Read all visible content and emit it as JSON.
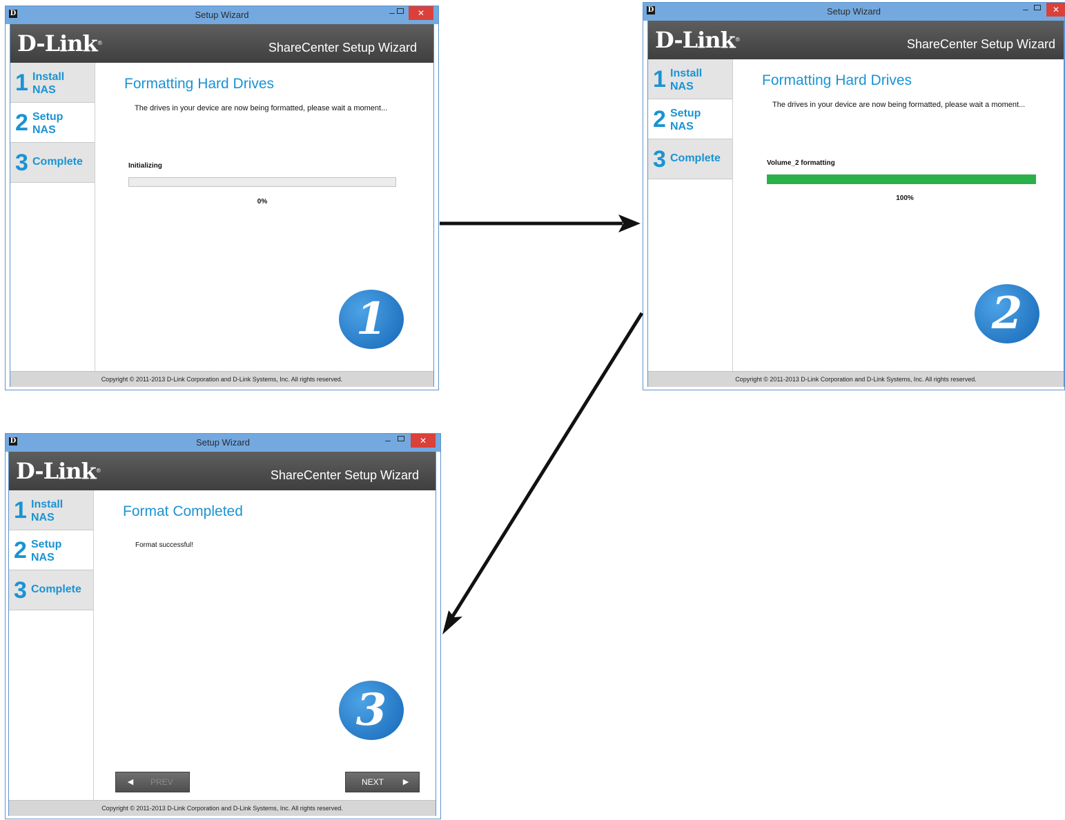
{
  "windows": [
    {
      "title": "Setup Wizard",
      "app_icon": "D",
      "brand": "D-Link",
      "subtitle": "ShareCenter Setup Wizard",
      "steps": [
        {
          "num": "1",
          "line1": "Install",
          "line2": "NAS"
        },
        {
          "num": "2",
          "line1": "Setup",
          "line2": "NAS"
        },
        {
          "num": "3",
          "line1": "Complete",
          "line2": ""
        }
      ],
      "heading": "Formatting Hard Drives",
      "description": "The drives in your device are now being formatted, please wait a moment...",
      "status": "Initializing",
      "progress_percent": 0,
      "progress_label": "0%",
      "badge": "1",
      "footer": "Copyright © 2011-2013 D-Link Corporation and D-Link Systems, Inc. All rights reserved."
    },
    {
      "title": "Setup Wizard",
      "app_icon": "D",
      "brand": "D-Link",
      "subtitle": "ShareCenter Setup Wizard",
      "steps": [
        {
          "num": "1",
          "line1": "Install",
          "line2": "NAS"
        },
        {
          "num": "2",
          "line1": "Setup",
          "line2": "NAS"
        },
        {
          "num": "3",
          "line1": "Complete",
          "line2": ""
        }
      ],
      "heading": "Formatting Hard Drives",
      "description": "The drives in your device are now being formatted, please wait a moment...",
      "status": "Volume_2 formatting",
      "progress_percent": 100,
      "progress_label": "100%",
      "badge": "2",
      "footer": "Copyright © 2011-2013 D-Link Corporation and D-Link Systems, Inc. All rights reserved."
    },
    {
      "title": "Setup Wizard",
      "app_icon": "D",
      "brand": "D-Link",
      "subtitle": "ShareCenter Setup Wizard",
      "steps": [
        {
          "num": "1",
          "line1": "Install",
          "line2": "NAS"
        },
        {
          "num": "2",
          "line1": "Setup",
          "line2": "NAS"
        },
        {
          "num": "3",
          "line1": "Complete",
          "line2": ""
        }
      ],
      "heading": "Format Completed",
      "description": "Format successful!",
      "badge": "3",
      "prev_label": "PREV",
      "next_label": "NEXT",
      "footer": "Copyright © 2011-2013 D-Link Corporation and D-Link Systems, Inc. All rights reserved."
    }
  ],
  "colors": {
    "accent": "#1a93d3",
    "header": "#4a4a4a",
    "progress": "#2bb04a",
    "badge": "#1f77c8",
    "close": "#d9413a"
  }
}
